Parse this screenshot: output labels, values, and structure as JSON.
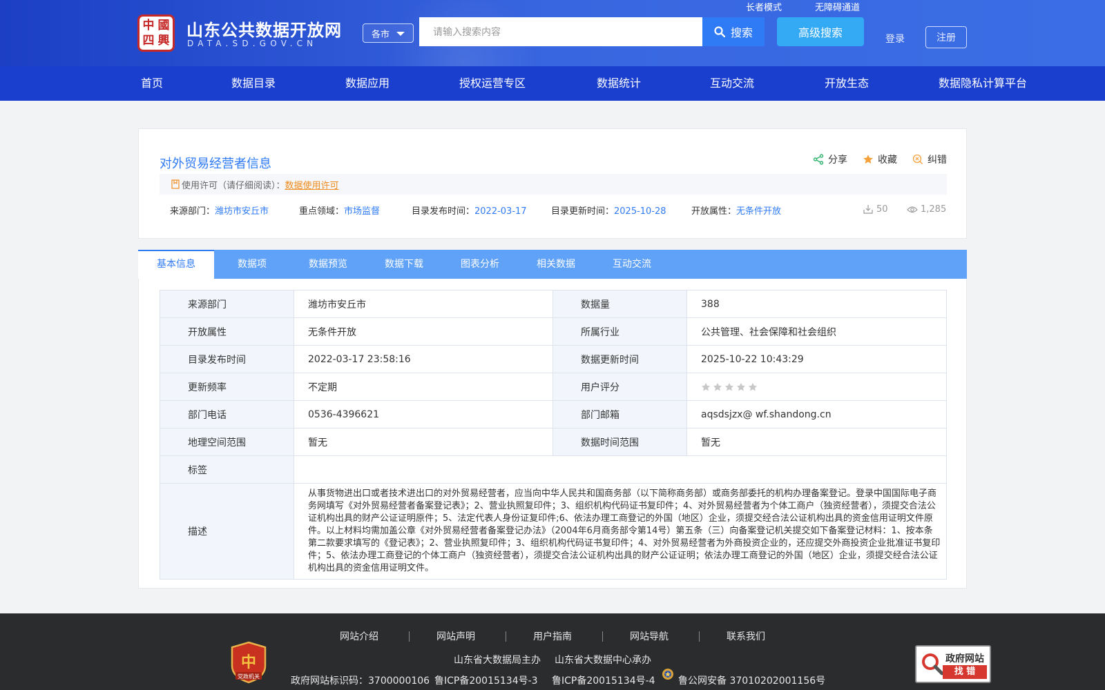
{
  "header": {
    "logo_seal_chars": [
      "中",
      "國",
      "四",
      "興"
    ],
    "logo_title": "山东公共数据开放网",
    "logo_sub": "DATA.SD.GOV.CN",
    "city_select": "各市",
    "search_placeholder": "请输入搜索内容",
    "search_label": "搜索",
    "advanced_search": "高级搜索",
    "elder_mode": "长者模式",
    "accessibility": "无障碍通道",
    "login": "登录",
    "register": "注册"
  },
  "nav": [
    "首页",
    "数据目录",
    "数据应用",
    "授权运营专区",
    "数据统计",
    "互动交流",
    "开放生态",
    "数据隐私计算平台"
  ],
  "dataset": {
    "title": "对外贸易经营者信息",
    "actions": {
      "share": "分享",
      "favorite": "收藏",
      "correct": "纠错"
    },
    "license_prefix": "使用许可（请仔细阅读）：",
    "license_link": "数据使用许可",
    "meta": {
      "source_label": "来源部门：",
      "source_value": "潍坊市安丘市",
      "domain_label": "重点领域：",
      "domain_value": "市场监督",
      "publish_label": "目录发布时间：",
      "publish_value": "2022-03-17",
      "update_label": "目录更新时间：",
      "update_value": "2025-10-28",
      "open_label": "开放属性：",
      "open_value": "无条件开放"
    },
    "downloads": "50",
    "views": "1,285"
  },
  "tabs": [
    "基本信息",
    "数据项",
    "数据预览",
    "数据下载",
    "图表分析",
    "相关数据",
    "互动交流"
  ],
  "info": {
    "source_dept_k": "来源部门",
    "source_dept_v": "潍坊市安丘市",
    "data_volume_k": "数据量",
    "data_volume_v": "388",
    "open_attr_k": "开放属性",
    "open_attr_v": "无条件开放",
    "industry_k": "所属行业",
    "industry_v": "公共管理、社会保障和社会组织",
    "publish_time_k": "目录发布时间",
    "publish_time_v": "2022-03-17 23:58:16",
    "update_time_k": "数据更新时间",
    "update_time_v": "2025-10-22 10:43:29",
    "freq_k": "更新频率",
    "freq_v": "不定期",
    "rating_k": "用户评分",
    "rating_value": 0,
    "phone_k": "部门电话",
    "phone_v": "0536-4396621",
    "email_k": "部门邮箱",
    "email_v": "aqsdsjzx@ wf.shandong.cn",
    "geo_k": "地理空间范围",
    "geo_v": "暂无",
    "time_range_k": "数据时间范围",
    "time_range_v": "暂无",
    "tags_k": "标签",
    "tags_v": "",
    "desc_k": "描述",
    "desc_v": "从事货物进出口或者技术进出口的对外贸易经营者，应当向中华人民共和国商务部（以下简称商务部）或商务部委托的机构办理备案登记。登录中国国际电子商务网填写《对外贸易经营者备案登记表》；2、营业执照复印件；3、组织机构代码证书复印件；4、对外贸易经营者为个体工商户（独资经营者），须提交合法公证机构出具的财产公证证明原件；5、法定代表人身份证复印件;6、依法办理工商登记的外国（地区）企业，须提交经合法公证机构出具的资金信用证明文件原件。以上材料均需加盖公章《对外贸易经营者备案登记办法》（2004年6月商务部令第14号）第五条（三）向备案登记机关提交如下备案登记材料：1、按本条第二款要求填写的《登记表》；2、营业执照复印件；3、组织机构代码证书复印件；4、对外贸易经营者为外商投资企业的，还应提交外商投资企业批准证书复印件；5、依法办理工商登记的个体工商户（独资经营者），须提交合法公证机构出具的财产公证证明；依法办理工商登记的外国（地区）企业，须提交经合法公证机构出具的资金信用证明文件。"
  },
  "footer": {
    "links": [
      "网站介绍",
      "网站声明",
      "用户指南",
      "网站导航",
      "联系我们"
    ],
    "host": "山东省大数据局主办",
    "undertake": "山东省大数据中心承办",
    "site_code": "政府网站标识码：3700000106",
    "icp1": "鲁ICP备20015134号-3",
    "icp2": "鲁ICP备20015134号-4",
    "police": "鲁公网安备 37010202001156号",
    "badge_label": "党政机关",
    "zhaocuo_t1": "政府网站",
    "zhaocuo_t2": "找 错"
  },
  "colors": {
    "primary": "#2f7bf5",
    "nav": "#1a3fcf",
    "tabbar": "#5fa2f7",
    "orange": "#f08c1e",
    "footer": "#2b2c2e"
  }
}
